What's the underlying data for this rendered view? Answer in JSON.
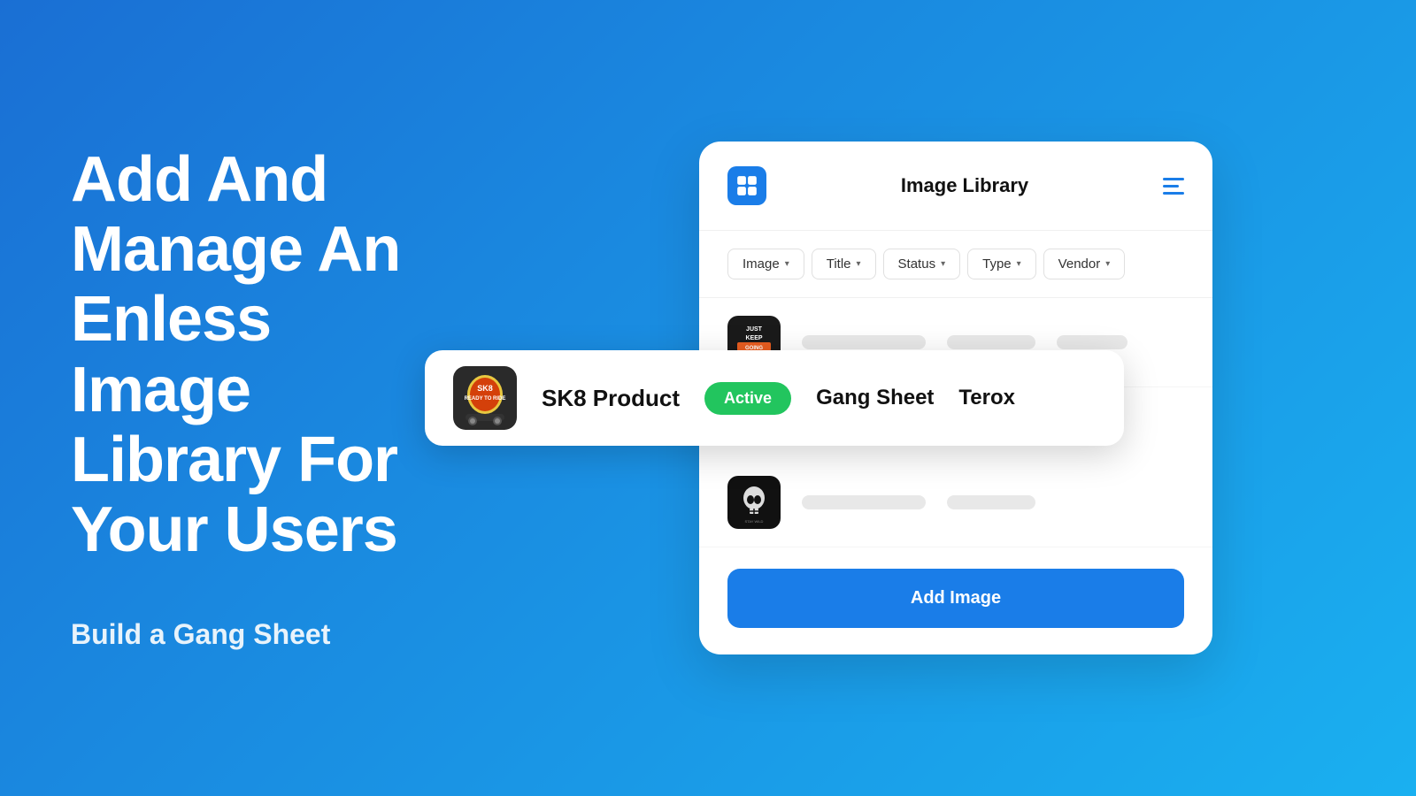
{
  "page": {
    "background_gradient_start": "#1a6fd4",
    "background_gradient_end": "#1ab0f0"
  },
  "left": {
    "hero_title": "Add And Manage An Enless Image Library For Your Users",
    "subtitle": "Build a Gang Sheet"
  },
  "panel": {
    "title": "Image Library",
    "logo_alt": "App Logo",
    "filters": [
      {
        "label": "Image",
        "id": "filter-image"
      },
      {
        "label": "Title",
        "id": "filter-title"
      },
      {
        "label": "Status",
        "id": "filter-status"
      },
      {
        "label": "Type",
        "id": "filter-type"
      },
      {
        "label": "Vendor",
        "id": "filter-vendor"
      }
    ],
    "add_image_button": "Add Image"
  },
  "highlighted_row": {
    "product_name": "SK8 Product",
    "status": "Active",
    "type": "Gang Sheet",
    "vendor": "Terox"
  },
  "icons": {
    "hamburger": "≡",
    "chevron_down": "▾"
  }
}
